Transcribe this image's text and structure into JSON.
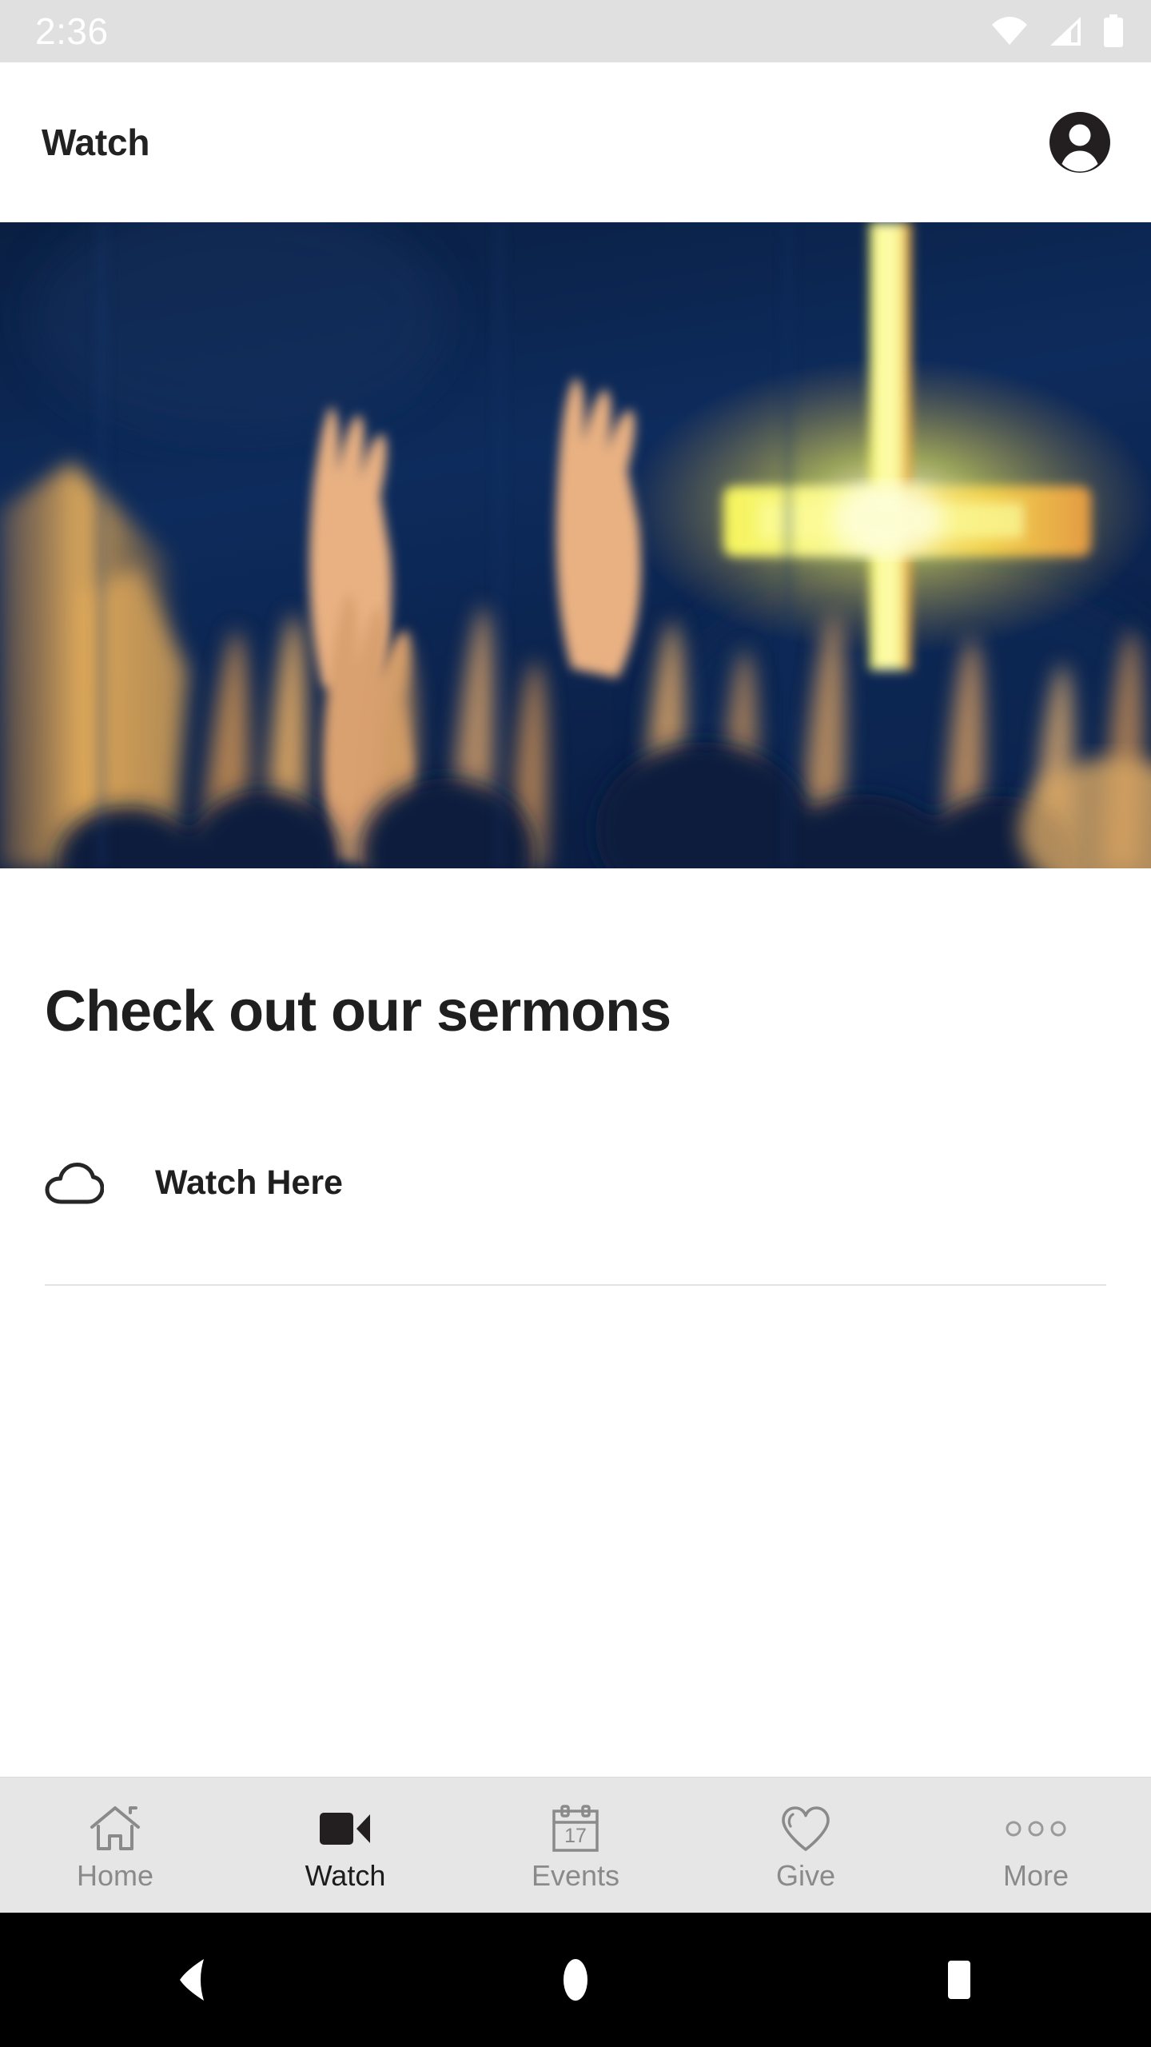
{
  "status_bar": {
    "time": "2:36",
    "icons": [
      "wifi-icon",
      "cellular-signal-icon",
      "battery-icon"
    ],
    "background": "#e0e0e0",
    "foreground": "#ffffff"
  },
  "header": {
    "title": "Watch",
    "avatar_icon": "account-circle-icon"
  },
  "hero": {
    "alt": "Worship crowd with raised hands before a glowing cross",
    "background_color": "#0a2044",
    "cross_color": "#f2f25a",
    "crowd_color": "#d89a5c"
  },
  "main": {
    "heading": "Check out our sermons",
    "links": [
      {
        "label": "Watch Here",
        "icon": "cloud-icon"
      }
    ]
  },
  "tab_bar": {
    "background": "#e6e6e6",
    "active_color": "#1c1c1c",
    "inactive_color": "#8a8a8a",
    "active_index": 1,
    "items": [
      {
        "label": "Home",
        "icon": "home-icon"
      },
      {
        "label": "Watch",
        "icon": "video-camera-icon"
      },
      {
        "label": "Events",
        "icon": "calendar-icon",
        "badge": "17"
      },
      {
        "label": "Give",
        "icon": "heart-icon"
      },
      {
        "label": "More",
        "icon": "ellipsis-icon"
      }
    ]
  },
  "nav_bar": {
    "background": "#000000",
    "buttons": [
      {
        "name": "back",
        "icon": "back-triangle-icon"
      },
      {
        "name": "home",
        "icon": "home-circle-icon"
      },
      {
        "name": "recents",
        "icon": "recents-square-icon"
      }
    ]
  }
}
